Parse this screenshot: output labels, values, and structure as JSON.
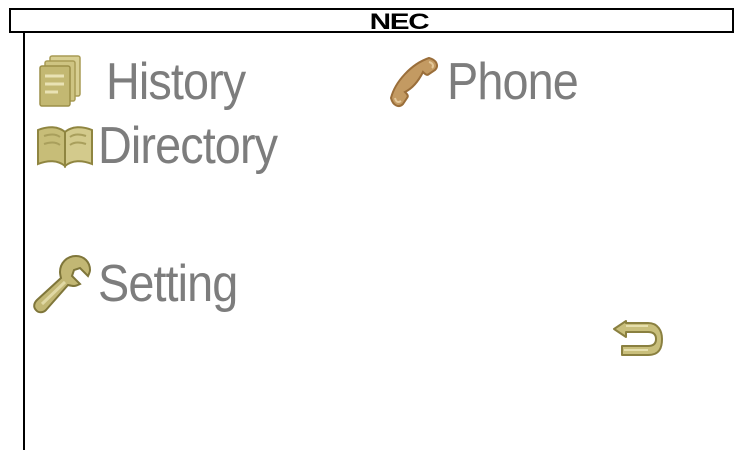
{
  "header": {
    "brand": "NEC"
  },
  "menu": {
    "history_label": "History",
    "phone_label": "Phone",
    "directory_label": "Directory",
    "setting_label": "Setting"
  },
  "icons": {
    "history": "history-document-icon",
    "phone": "phone-handset-icon",
    "directory": "directory-book-icon",
    "setting": "wrench-icon",
    "back": "back-arrow-icon"
  },
  "colors": {
    "label_text": "#7d7d7d",
    "icon_khaki": "#c9bf7c",
    "phone_icon": "#b98a52"
  }
}
